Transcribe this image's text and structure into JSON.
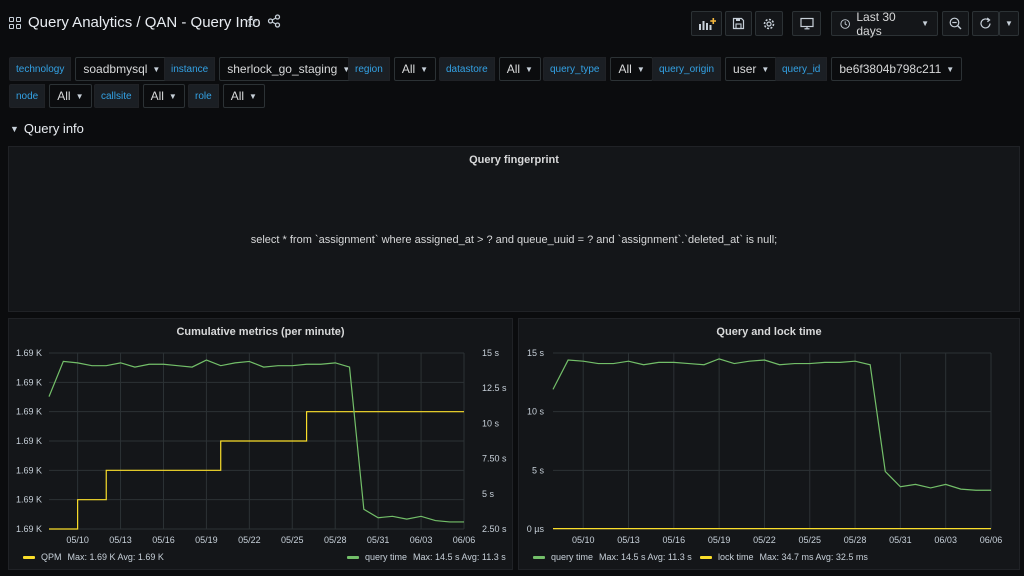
{
  "header": {
    "title": "Query Analytics / QAN - Query Info",
    "time_range": "Last 30 days",
    "icons": [
      "apps-icon",
      "star-icon",
      "share-icon",
      "add-panel-icon",
      "save-icon",
      "settings-icon",
      "tv-mode-icon",
      "clock-icon",
      "zoom-out-icon",
      "refresh-icon",
      "chevron-down-icon"
    ]
  },
  "variables": [
    {
      "label": "technology",
      "value": "soadbmysql"
    },
    {
      "label": "instance",
      "value": "sherlock_go_staging"
    },
    {
      "label": "region",
      "value": "All"
    },
    {
      "label": "datastore",
      "value": "All"
    },
    {
      "label": "query_type",
      "value": "All"
    },
    {
      "label": "query_origin",
      "value": "user"
    },
    {
      "label": "query_id",
      "value": "be6f3804b798c211"
    },
    {
      "label": "node",
      "value": "All"
    },
    {
      "label": "callsite",
      "value": "All"
    },
    {
      "label": "role",
      "value": "All"
    }
  ],
  "row": {
    "title": "Query info"
  },
  "fingerprint": {
    "title": "Query fingerprint",
    "text": "select * from `assignment` where assigned_at > ? and queue_uuid = ? and `assignment`.`deleted_at` is null;"
  },
  "colors": {
    "green": "#73bf69",
    "yellow": "#fade2a",
    "accent": "#33a2e5"
  },
  "chart_data": [
    {
      "type": "line",
      "title": "Cumulative metrics (per minute)",
      "x": [
        "05/08",
        "05/09",
        "05/10",
        "05/11",
        "05/12",
        "05/13",
        "05/14",
        "05/15",
        "05/16",
        "05/17",
        "05/18",
        "05/19",
        "05/20",
        "05/21",
        "05/22",
        "05/23",
        "05/24",
        "05/25",
        "05/26",
        "05/27",
        "05/28",
        "05/29",
        "05/30",
        "05/31",
        "06/01",
        "06/02",
        "06/03",
        "06/04",
        "06/05",
        "06/06"
      ],
      "x_tick_labels": [
        "05/10",
        "05/13",
        "05/16",
        "05/19",
        "05/22",
        "05/25",
        "05/28",
        "05/31",
        "06/03",
        "06/06"
      ],
      "y_left_ticks": [
        "1.69 K",
        "1.69 K",
        "1.69 K",
        "1.69 K",
        "1.69 K",
        "1.69 K",
        "1.69 K"
      ],
      "y_right_ticks": [
        "2.50 s",
        "5 s",
        "7.50 s",
        "10 s",
        "12.5 s",
        "15 s"
      ],
      "y_right_lim": [
        2.5,
        15
      ],
      "y_left_lim": [
        0,
        6
      ],
      "series": [
        {
          "name": "QPM",
          "axis": "left",
          "color": "#fade2a",
          "values": [
            0,
            0,
            1,
            1,
            2,
            2,
            2,
            2,
            2,
            2,
            2,
            2,
            3,
            3,
            3,
            3,
            3,
            3,
            4,
            4,
            4,
            4,
            4,
            4,
            4,
            4,
            4,
            4,
            4,
            4
          ],
          "legend_stats": "Max: 1.69 K  Avg: 1.69 K"
        },
        {
          "name": "query time",
          "axis": "right",
          "color": "#73bf69",
          "values": [
            11.9,
            14.4,
            14.3,
            14.1,
            14.1,
            14.3,
            14.0,
            14.2,
            14.2,
            14.1,
            14.0,
            14.5,
            14.1,
            14.3,
            14.4,
            14.0,
            14.1,
            14.1,
            14.2,
            14.2,
            14.3,
            14.0,
            3.9,
            3.3,
            3.4,
            3.2,
            3.4,
            3.1,
            3.0,
            3.0
          ],
          "legend_stats": "Max: 14.5 s  Avg: 11.3 s"
        }
      ]
    },
    {
      "type": "line",
      "title": "Query and lock time",
      "x": [
        "05/08",
        "05/09",
        "05/10",
        "05/11",
        "05/12",
        "05/13",
        "05/14",
        "05/15",
        "05/16",
        "05/17",
        "05/18",
        "05/19",
        "05/20",
        "05/21",
        "05/22",
        "05/23",
        "05/24",
        "05/25",
        "05/26",
        "05/27",
        "05/28",
        "05/29",
        "05/30",
        "05/31",
        "06/01",
        "06/02",
        "06/03",
        "06/04",
        "06/05",
        "06/06"
      ],
      "x_tick_labels": [
        "05/10",
        "05/13",
        "05/16",
        "05/19",
        "05/22",
        "05/25",
        "05/28",
        "05/31",
        "06/03",
        "06/06"
      ],
      "y_ticks": [
        "0 µs",
        "5 s",
        "10 s",
        "15 s"
      ],
      "ylim": [
        0,
        15
      ],
      "series": [
        {
          "name": "query time",
          "color": "#73bf69",
          "values": [
            11.9,
            14.4,
            14.3,
            14.1,
            14.1,
            14.3,
            14.0,
            14.2,
            14.2,
            14.1,
            14.0,
            14.5,
            14.1,
            14.3,
            14.4,
            14.0,
            14.1,
            14.1,
            14.2,
            14.2,
            14.3,
            14.0,
            4.9,
            3.6,
            3.8,
            3.5,
            3.8,
            3.4,
            3.3,
            3.3
          ],
          "legend_stats": "Max: 14.5 s  Avg: 11.3 s"
        },
        {
          "name": "lock time",
          "color": "#fade2a",
          "values": [
            0.0325,
            0.0325,
            0.0325,
            0.0325,
            0.0325,
            0.0325,
            0.0325,
            0.0325,
            0.0325,
            0.0325,
            0.0325,
            0.0325,
            0.0325,
            0.0325,
            0.0325,
            0.0325,
            0.0325,
            0.0325,
            0.0325,
            0.0325,
            0.0325,
            0.0325,
            0.0325,
            0.0325,
            0.0325,
            0.0325,
            0.0325,
            0.0325,
            0.0325,
            0.0347
          ],
          "legend_stats": "Max: 34.7 ms  Avg: 32.5 ms"
        }
      ]
    }
  ]
}
